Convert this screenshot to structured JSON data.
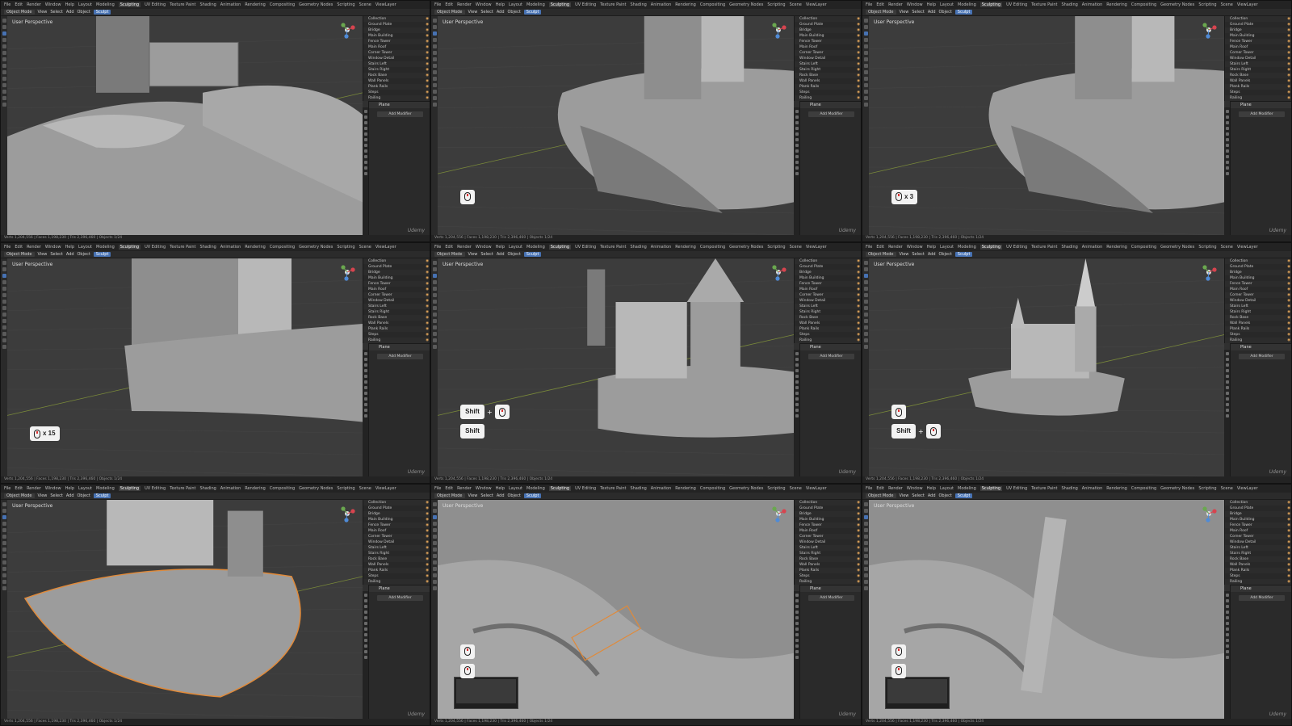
{
  "app": {
    "menu": [
      "File",
      "Edit",
      "Render",
      "Window",
      "Help"
    ],
    "workspaces": [
      "Layout",
      "Modeling",
      "Sculpting",
      "UV Editing",
      "Texture Paint",
      "Shading",
      "Animation",
      "Rendering",
      "Compositing",
      "Geometry Nodes",
      "Scripting"
    ],
    "active_workspace": "Sculpting",
    "scene": "Scene",
    "layer": "ViewLayer",
    "toolbar": [
      "Object Mode",
      "View",
      "Select",
      "Add",
      "Object"
    ],
    "selected_tool": "Sculpt",
    "status": "Verts 1,204,556 | Faces 1,198,230 | Tris 2,396,460 | Objects 1/24",
    "watermark": "Udemy"
  },
  "viewport_label": "User Perspective",
  "outliner_rows": [
    {
      "name": "Collection",
      "v": "◉"
    },
    {
      "name": "Ground Plate",
      "v": "◉"
    },
    {
      "name": "Bridge",
      "v": "◉"
    },
    {
      "name": "Main Building",
      "v": "◉"
    },
    {
      "name": "Fence Tower",
      "v": "◉"
    },
    {
      "name": "Main Roof",
      "v": "◉"
    },
    {
      "name": "Corner Tower",
      "v": "◉"
    },
    {
      "name": "Window Detail",
      "v": "◉"
    },
    {
      "name": "Stairs Left",
      "v": "◉"
    },
    {
      "name": "Stairs Right",
      "v": "◉"
    },
    {
      "name": "Rock Base",
      "v": "◉"
    },
    {
      "name": "Wall Panels",
      "v": "◉"
    },
    {
      "name": "Plank Rails",
      "v": "◉"
    },
    {
      "name": "Steps",
      "v": "◉"
    },
    {
      "name": "Railing",
      "v": "◉"
    },
    {
      "name": "Doors",
      "v": "◉"
    },
    {
      "name": "Walkway",
      "v": "◉"
    },
    {
      "name": "Character",
      "v": "◉"
    }
  ],
  "props_header": "Plane",
  "props_button": "Add Modifier",
  "shortcuts": {
    "mouse_label": "",
    "x3": "x 3",
    "x15": "x 15",
    "shift": "Shift",
    "plus": "+"
  },
  "panels": [
    {
      "id": "p1",
      "key": "none"
    },
    {
      "id": "p2",
      "key": "mouse"
    },
    {
      "id": "p3",
      "key": "mouse-x3"
    },
    {
      "id": "p4",
      "key": "mouse-x15"
    },
    {
      "id": "p5",
      "key": "shift-combo"
    },
    {
      "id": "p6",
      "key": "mouse-shift-combo"
    },
    {
      "id": "p7",
      "key": "none"
    },
    {
      "id": "p8",
      "key": "mouse-double"
    },
    {
      "id": "p9",
      "key": "mouse-double"
    }
  ],
  "colors": {
    "ui_dark": "#232323",
    "viewport_bg": "#3c3c3c",
    "model": "#9a9a9a",
    "selection": "#e08a3a",
    "accent": "#4772b3"
  }
}
